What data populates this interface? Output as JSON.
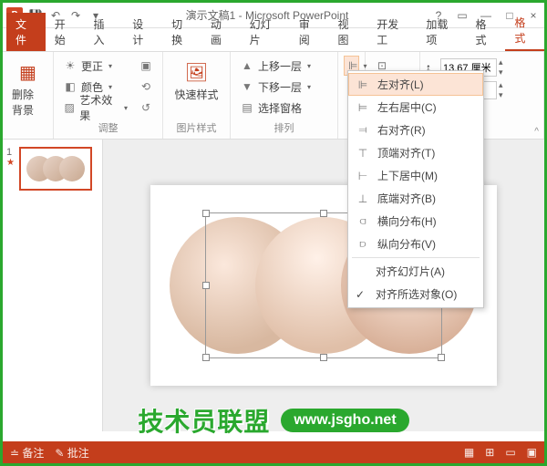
{
  "title": "演示文稿1 - Microsoft PowerPoint",
  "app_icon": "P",
  "tabs": {
    "file": "文件",
    "home": "开始",
    "insert": "插入",
    "design": "设计",
    "transitions": "切换",
    "animations": "动画",
    "slideshow": "幻灯片",
    "review": "审阅",
    "view": "视图",
    "developer": "开发工",
    "addins": "加载项",
    "format1": "格式",
    "format2": "格式"
  },
  "ribbon": {
    "remove_bg": "删除背景",
    "corrections": "更正",
    "color": "颜色",
    "artistic": "艺术效果",
    "adjust_label": "调整",
    "quick_styles": "快速样式",
    "picture_styles_label": "图片样式",
    "bring_forward": "上移一层",
    "send_backward": "下移一层",
    "selection_pane": "选择窗格",
    "arrange_label": "排列",
    "height_value": "13.67 厘米"
  },
  "align_menu": {
    "left": "左对齐(L)",
    "center_h": "左右居中(C)",
    "right": "右对齐(R)",
    "top": "顶端对齐(T)",
    "middle_v": "上下居中(M)",
    "bottom": "底端对齐(B)",
    "dist_h": "横向分布(H)",
    "dist_v": "纵向分布(V)",
    "align_slide": "对齐幻灯片(A)",
    "align_selected": "对齐所选对象(O)"
  },
  "slide_panel": {
    "num": "1"
  },
  "statusbar": {
    "notes": "备注",
    "comments": "批注"
  },
  "watermark": {
    "text": "技术员联盟",
    "url": "www.jsgho.net"
  }
}
